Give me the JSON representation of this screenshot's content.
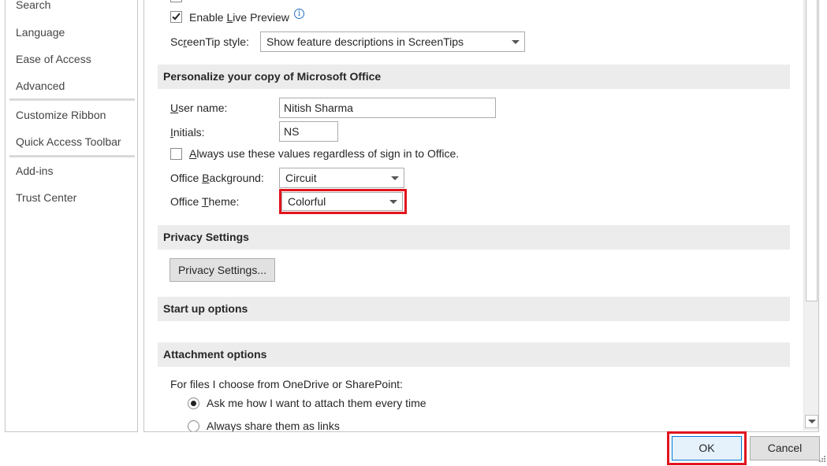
{
  "nav": {
    "items": [
      "Search",
      "Language",
      "Ease of Access",
      "Advanced",
      "Customize Ribbon",
      "Quick Access Toolbar",
      "Add-ins",
      "Trust Center"
    ]
  },
  "general": {
    "live_preview_label_pre": "Enable ",
    "live_preview_label_u": "L",
    "live_preview_label_post": "ive Preview",
    "live_preview_checked": true,
    "screentip_label_pre": "Sc",
    "screentip_label_u": "r",
    "screentip_label_post": "eenTip style:",
    "screentip_value": "Show feature descriptions in ScreenTips"
  },
  "personalize": {
    "header": "Personalize your copy of Microsoft Office",
    "username_label_u": "U",
    "username_label_post": "ser name:",
    "username_value": "Nitish Sharma",
    "initials_label_u": "I",
    "initials_label_post": "nitials:",
    "initials_value": "NS",
    "always_use_label_u": "A",
    "always_use_label_post": "lways use these values regardless of sign in to Office.",
    "always_use_checked": false,
    "background_label_pre": "Office ",
    "background_label_u": "B",
    "background_label_post": "ackground:",
    "background_value": "Circuit",
    "theme_label_pre": "Office ",
    "theme_label_u": "T",
    "theme_label_post": "heme:",
    "theme_value": "Colorful"
  },
  "privacy": {
    "header": "Privacy Settings",
    "button": "Privacy Settings..."
  },
  "startup": {
    "header": "Start up options"
  },
  "attachment": {
    "header": "Attachment options",
    "prompt": "For files I choose from OneDrive or SharePoint:",
    "options": [
      "Ask me how I want to attach them every time",
      "Always share them as links"
    ],
    "selected_index": 0
  },
  "footer": {
    "ok": "OK",
    "cancel": "Cancel"
  },
  "colors": {
    "highlight": "#e0141e",
    "section_bg": "#ececec",
    "info_blue": "#2b6fc7"
  }
}
